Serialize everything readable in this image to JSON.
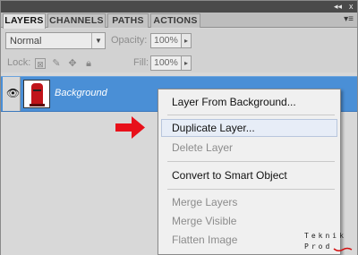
{
  "window": {
    "collapse_glyph": "◂◂",
    "close_glyph": "x"
  },
  "tabs": [
    {
      "label": "LAYERS",
      "active": true
    },
    {
      "label": "CHANNELS",
      "active": false
    },
    {
      "label": "PATHS",
      "active": false
    },
    {
      "label": "ACTIONS",
      "active": false
    }
  ],
  "panel_menu_icon": "panel-menu-icon",
  "blend": {
    "mode": "Normal"
  },
  "opacity": {
    "label": "Opacity:",
    "value": "100%"
  },
  "lock": {
    "label": "Lock:"
  },
  "fill": {
    "label": "Fill:",
    "value": "100%"
  },
  "layer": {
    "name": "Background",
    "visible": true,
    "thumbnail": "red-postbox-thumbnail",
    "locked": true
  },
  "context_menu": {
    "items": [
      {
        "label": "Layer From Background...",
        "enabled": true
      },
      {
        "label": "Duplicate Layer...",
        "enabled": true,
        "highlighted": true
      },
      {
        "label": "Delete Layer",
        "enabled": false
      },
      {
        "label": "Convert to Smart Object",
        "enabled": true
      },
      {
        "label": "Merge Layers",
        "enabled": false
      },
      {
        "label": "Merge Visible",
        "enabled": false
      },
      {
        "label": "Flatten Image",
        "enabled": false
      }
    ]
  },
  "watermark": {
    "line1": "Teknik",
    "line2": "Prod"
  },
  "colors": {
    "selection": "#4a8fd6",
    "arrow": "#e8101a",
    "menu_bg": "#f0f0f0"
  }
}
